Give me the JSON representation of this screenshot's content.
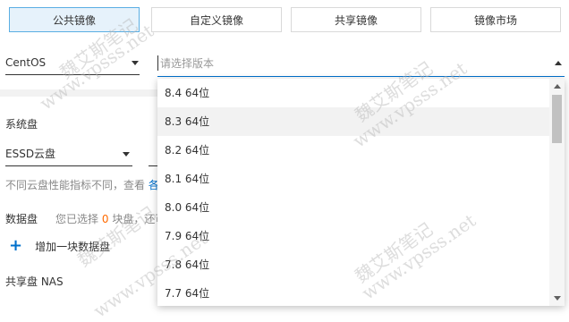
{
  "tabs": [
    {
      "label": "公共镜像",
      "active": true
    },
    {
      "label": "自定义镜像",
      "active": false
    },
    {
      "label": "共享镜像",
      "active": false
    },
    {
      "label": "镜像市场",
      "active": false
    }
  ],
  "os_select": {
    "value": "CentOS"
  },
  "version_select": {
    "placeholder": "请选择版本"
  },
  "version_options": [
    "8.4 64位",
    "8.3 64位",
    "8.2 64位",
    "8.1 64位",
    "8.0 64位",
    "7.9 64位",
    "7.8 64位",
    "7.7 64位"
  ],
  "system_disk": {
    "label": "系统盘",
    "type_value": "ESSD云盘",
    "hint": "不同云盘性能指标不同，查看",
    "hint_link": "各"
  },
  "data_disk": {
    "label": "数据盘",
    "hint_prefix": "您已选择",
    "count": "0",
    "hint_suffix": "块盘，还可",
    "add_label": "增加一块数据盘"
  },
  "shared_disk": {
    "label": "共享盘 NAS"
  },
  "edge_text": "l",
  "watermark": {
    "cn": "魏艾斯笔记",
    "url": "www.vpsss.net"
  },
  "colors": {
    "accent": "#0070cc",
    "tab_active_bg": "#e6f2fb",
    "tab_active_border": "#5aaee3",
    "count": "#ff6a00"
  }
}
